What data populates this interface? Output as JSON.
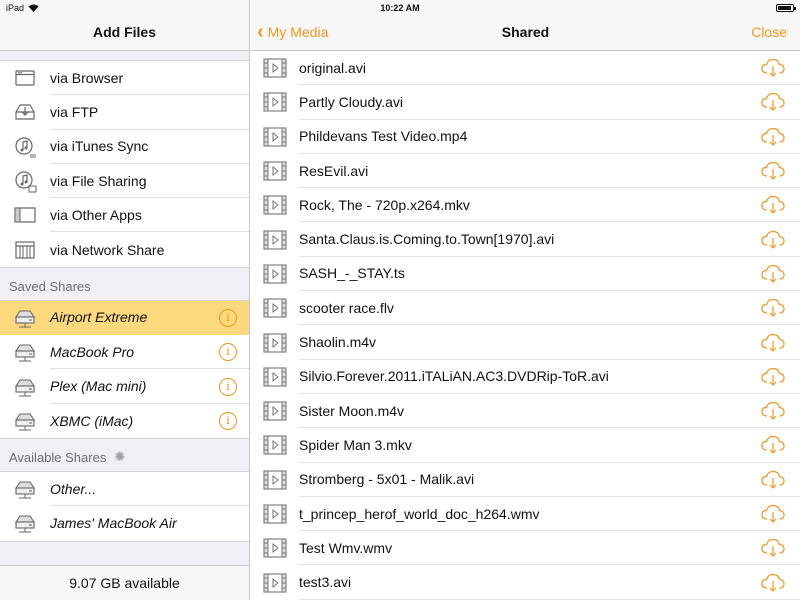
{
  "status_bar": {
    "device": "iPad",
    "time": "10:22 AM"
  },
  "sidebar": {
    "title": "Add Files",
    "add_items": [
      {
        "label": "via Browser",
        "icon": "browser-window-icon"
      },
      {
        "label": "via FTP",
        "icon": "ftp-tray-icon"
      },
      {
        "label": "via iTunes Sync",
        "icon": "itunes-sync-icon"
      },
      {
        "label": "via File Sharing",
        "icon": "file-sharing-icon"
      },
      {
        "label": "via Other Apps",
        "icon": "other-apps-icon"
      },
      {
        "label": "via Network Share",
        "icon": "network-share-icon"
      }
    ],
    "saved_title": "Saved Shares",
    "saved_items": [
      {
        "label": "Airport Extreme",
        "selected": true
      },
      {
        "label": "MacBook Pro"
      },
      {
        "label": "Plex (Mac mini)"
      },
      {
        "label": "XBMC (iMac)"
      }
    ],
    "available_title": "Available Shares",
    "available_items": [
      {
        "label": "Other..."
      },
      {
        "label": "James' MacBook Air"
      }
    ],
    "footer": "9.07 GB available"
  },
  "main": {
    "back_label": "My Media",
    "title": "Shared",
    "close_label": "Close",
    "files": [
      "original.avi",
      "Partly Cloudy.avi",
      "Phildevans Test Video.mp4",
      "ResEvil.avi",
      "Rock, The - 720p.x264.mkv",
      "Santa.Claus.is.Coming.to.Town[1970].avi",
      "SASH_-_STAY.ts",
      "scooter race.flv",
      "Shaolin.m4v",
      "Silvio.Forever.2011.iTALiAN.AC3.DVDRip-ToR.avi",
      "Sister Moon.m4v",
      "Spider Man 3.mkv",
      "Stromberg - 5x01 - Malik.avi",
      "t_princep_herof_world_doc_h264.wmv",
      "Test Wmv.wmv",
      "test3.avi"
    ]
  },
  "colors": {
    "accent": "#f0961d",
    "selected_row": "#fcd97c"
  }
}
